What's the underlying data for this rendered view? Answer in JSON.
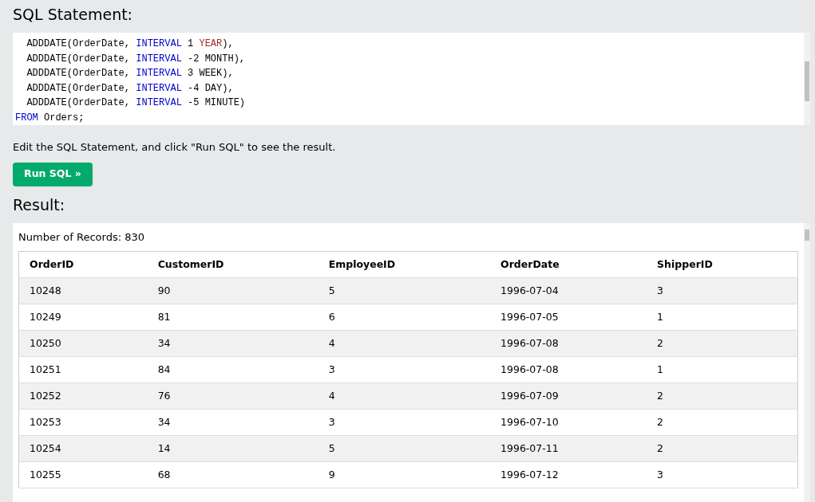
{
  "sql_heading": "SQL Statement:",
  "code_lines": [
    [
      {
        "kind": "plain",
        "text": "  ADDDATE(OrderDate, "
      },
      {
        "kind": "keyword",
        "text": "INTERVAL"
      },
      {
        "kind": "plain",
        "text": " 1 "
      },
      {
        "kind": "unit",
        "text": "YEAR"
      },
      {
        "kind": "plain",
        "text": "),"
      }
    ],
    [
      {
        "kind": "plain",
        "text": "  ADDDATE(OrderDate, "
      },
      {
        "kind": "keyword",
        "text": "INTERVAL"
      },
      {
        "kind": "plain",
        "text": " -2 MONTH),"
      }
    ],
    [
      {
        "kind": "plain",
        "text": "  ADDDATE(OrderDate, "
      },
      {
        "kind": "keyword",
        "text": "INTERVAL"
      },
      {
        "kind": "plain",
        "text": " 3 WEEK),"
      }
    ],
    [
      {
        "kind": "plain",
        "text": "  ADDDATE(OrderDate, "
      },
      {
        "kind": "keyword",
        "text": "INTERVAL"
      },
      {
        "kind": "plain",
        "text": " -4 DAY),"
      }
    ],
    [
      {
        "kind": "plain",
        "text": "  ADDDATE(OrderDate, "
      },
      {
        "kind": "keyword",
        "text": "INTERVAL"
      },
      {
        "kind": "plain",
        "text": " -5 MINUTE)"
      }
    ],
    [
      {
        "kind": "keyword",
        "text": "FROM"
      },
      {
        "kind": "plain",
        "text": " Orders;"
      }
    ]
  ],
  "instruction": "Edit the SQL Statement, and click \"Run SQL\" to see the result.",
  "run_button": "Run SQL »",
  "result_heading": "Result:",
  "record_count": "Number of Records: 830",
  "table": {
    "columns": [
      "OrderID",
      "CustomerID",
      "EmployeeID",
      "OrderDate",
      "ShipperID"
    ],
    "rows": [
      [
        "10248",
        "90",
        "5",
        "1996-07-04",
        "3"
      ],
      [
        "10249",
        "81",
        "6",
        "1996-07-05",
        "1"
      ],
      [
        "10250",
        "34",
        "4",
        "1996-07-08",
        "2"
      ],
      [
        "10251",
        "84",
        "3",
        "1996-07-08",
        "1"
      ],
      [
        "10252",
        "76",
        "4",
        "1996-07-09",
        "2"
      ],
      [
        "10253",
        "34",
        "3",
        "1996-07-10",
        "2"
      ],
      [
        "10254",
        "14",
        "5",
        "1996-07-11",
        "2"
      ],
      [
        "10255",
        "68",
        "9",
        "1996-07-12",
        "3"
      ]
    ]
  }
}
